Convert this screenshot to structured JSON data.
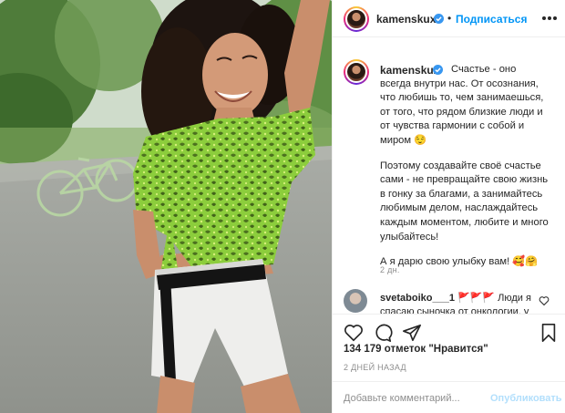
{
  "post": {
    "username": "kamenskux",
    "follow_label": "Подписаться",
    "separator": "•",
    "caption": {
      "p1": "Счастье - оно всегда внутри нас. От осознания, что любишь то, чем занимаешься, от того, что рядом близкие люди и от чувства гармонии с собой и миром 😌",
      "p2": "Поэтому создавайте своё счастье сами - не превращайте свою жизнь в гонку за благами, а занимайтесь любимым делом, наслаждайтесь каждым моментом, любите и много улыбайтесь!",
      "p3": "А я дарю свою улыбку вам! 🥰🤗"
    },
    "caption_time": "2 дн.",
    "comment": {
      "username": "svetaboiko___1",
      "text": "🚩🚩🚩 Люди я спасаю сыночка от онкологии, у"
    },
    "likes": "134 179 отметок \"Нравится\"",
    "posted_ago": "2 ДНЕЙ НАЗАД",
    "add_comment_placeholder": "Добавьте комментарий...",
    "publish_label": "Опубликовать"
  },
  "icons": [
    "verified-icon",
    "more-icon",
    "heart-icon",
    "comment-icon",
    "share-icon",
    "bookmark-icon"
  ],
  "colors": {
    "accent": "#0095f6",
    "publish_disabled": "#b2dffc",
    "muted": "#8e8e8e",
    "text": "#262626",
    "border": "#efefef"
  }
}
